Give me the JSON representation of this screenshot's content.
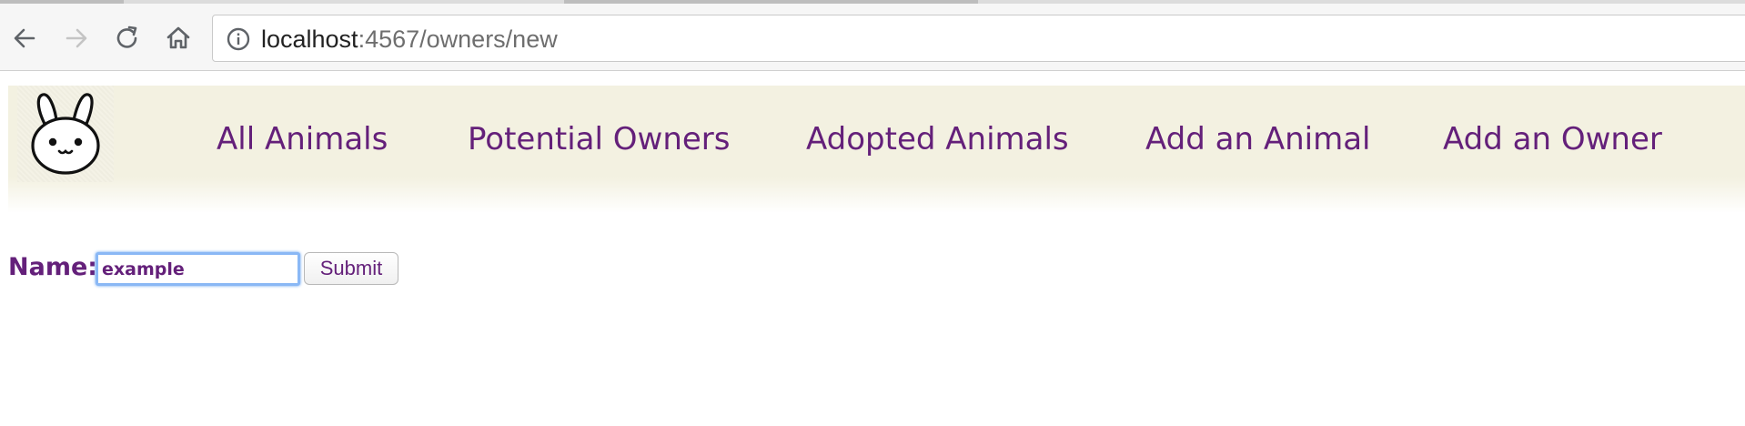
{
  "browser": {
    "url_host": "localhost",
    "url_path": ":4567/owners/new",
    "icons": {
      "back": "back-arrow-icon",
      "forward": "forward-arrow-icon",
      "reload": "reload-icon",
      "home": "home-icon",
      "site_info": "info-icon"
    }
  },
  "header": {
    "logo_icon": "bunny-icon",
    "nav": [
      {
        "label": "All Animals"
      },
      {
        "label": "Potential Owners"
      },
      {
        "label": "Adopted Animals"
      },
      {
        "label": "Add an Animal"
      },
      {
        "label": "Add an Owner"
      }
    ]
  },
  "form": {
    "name_label": "Name:",
    "name_value": "example",
    "submit_label": "Submit"
  },
  "colors": {
    "link": "#64207a",
    "header_bg": "#f3f1e1",
    "focus_ring": "#8ab8f5"
  }
}
